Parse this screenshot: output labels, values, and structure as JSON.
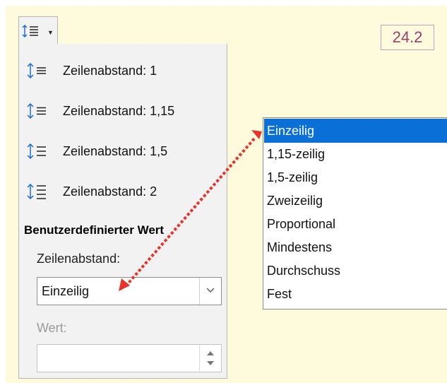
{
  "figure_number": "24.2",
  "toolbar": {
    "button_icon": "line-spacing-icon",
    "caret_icon": "chevron-down-icon"
  },
  "menu": {
    "items": [
      {
        "label": "Zeilenabstand: 1",
        "icon": "line-spacing-1-icon"
      },
      {
        "label": "Zeilenabstand: 1,15",
        "icon": "line-spacing-115-icon"
      },
      {
        "label": "Zeilenabstand: 1,5",
        "icon": "line-spacing-15-icon"
      },
      {
        "label": "Zeilenabstand: 2",
        "icon": "line-spacing-2-icon"
      }
    ],
    "section_title": "Benutzerdefinierter Wert",
    "spacing_label": "Zeilenabstand:",
    "spacing_value": "Einzeilig",
    "value_label": "Wert:",
    "value_input": ""
  },
  "dropdown": {
    "options": [
      "Einzeilig",
      "1,15-zeilig",
      "1,5-zeilig",
      "Zweizeilig",
      "Proportional",
      "Mindestens",
      "Durchschuss",
      "Fest"
    ],
    "selected": "Einzeilig"
  },
  "colors": {
    "background": "#fdfbdc",
    "selection": "#0a6fd6",
    "arrow": "#e8332b",
    "figure_number": "#9b3f73"
  }
}
